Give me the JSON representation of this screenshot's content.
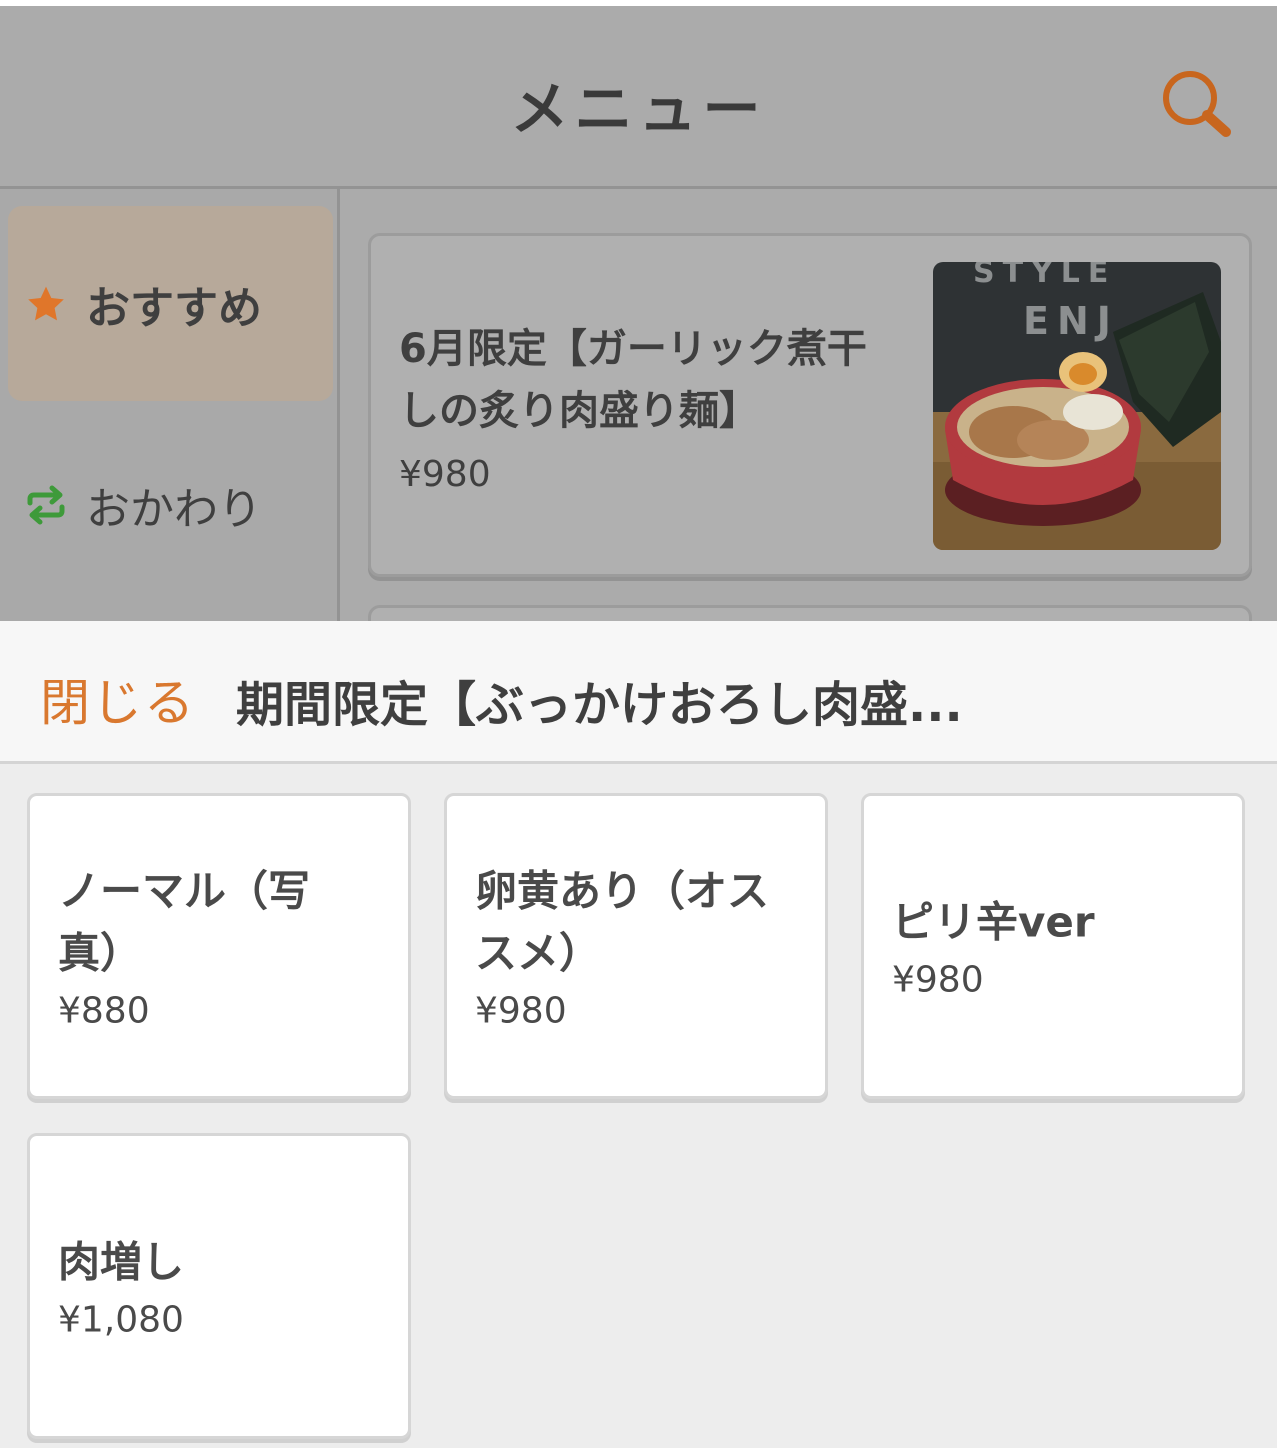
{
  "header": {
    "title": "メニュー",
    "search_icon": "search-icon"
  },
  "sidebar": {
    "items": [
      {
        "label": "おすすめ",
        "icon": "star-icon",
        "active": true
      },
      {
        "label": "おかわり",
        "icon": "repeat-icon",
        "active": false
      }
    ]
  },
  "menu": {
    "items": [
      {
        "title": "6月限定【ガーリック煮干しの炙り肉盛り麺】",
        "price": "¥980",
        "image": "ramen-photo"
      }
    ]
  },
  "sheet": {
    "close_label": "閉じる",
    "title": "期間限定【ぶっかけおろし肉盛...",
    "options": [
      {
        "label": "ノーマル（写真）",
        "price": "¥880"
      },
      {
        "label": "卵黄あり（オススメ）",
        "price": "¥980"
      },
      {
        "label": "ピリ辛ver",
        "price": "¥980"
      },
      {
        "label": "肉増し",
        "price": "¥1,080"
      }
    ]
  },
  "colors": {
    "accent": "#d9782f",
    "star": "#e0762a",
    "repeat": "#3e9a3a",
    "overlay": "#ababab"
  }
}
